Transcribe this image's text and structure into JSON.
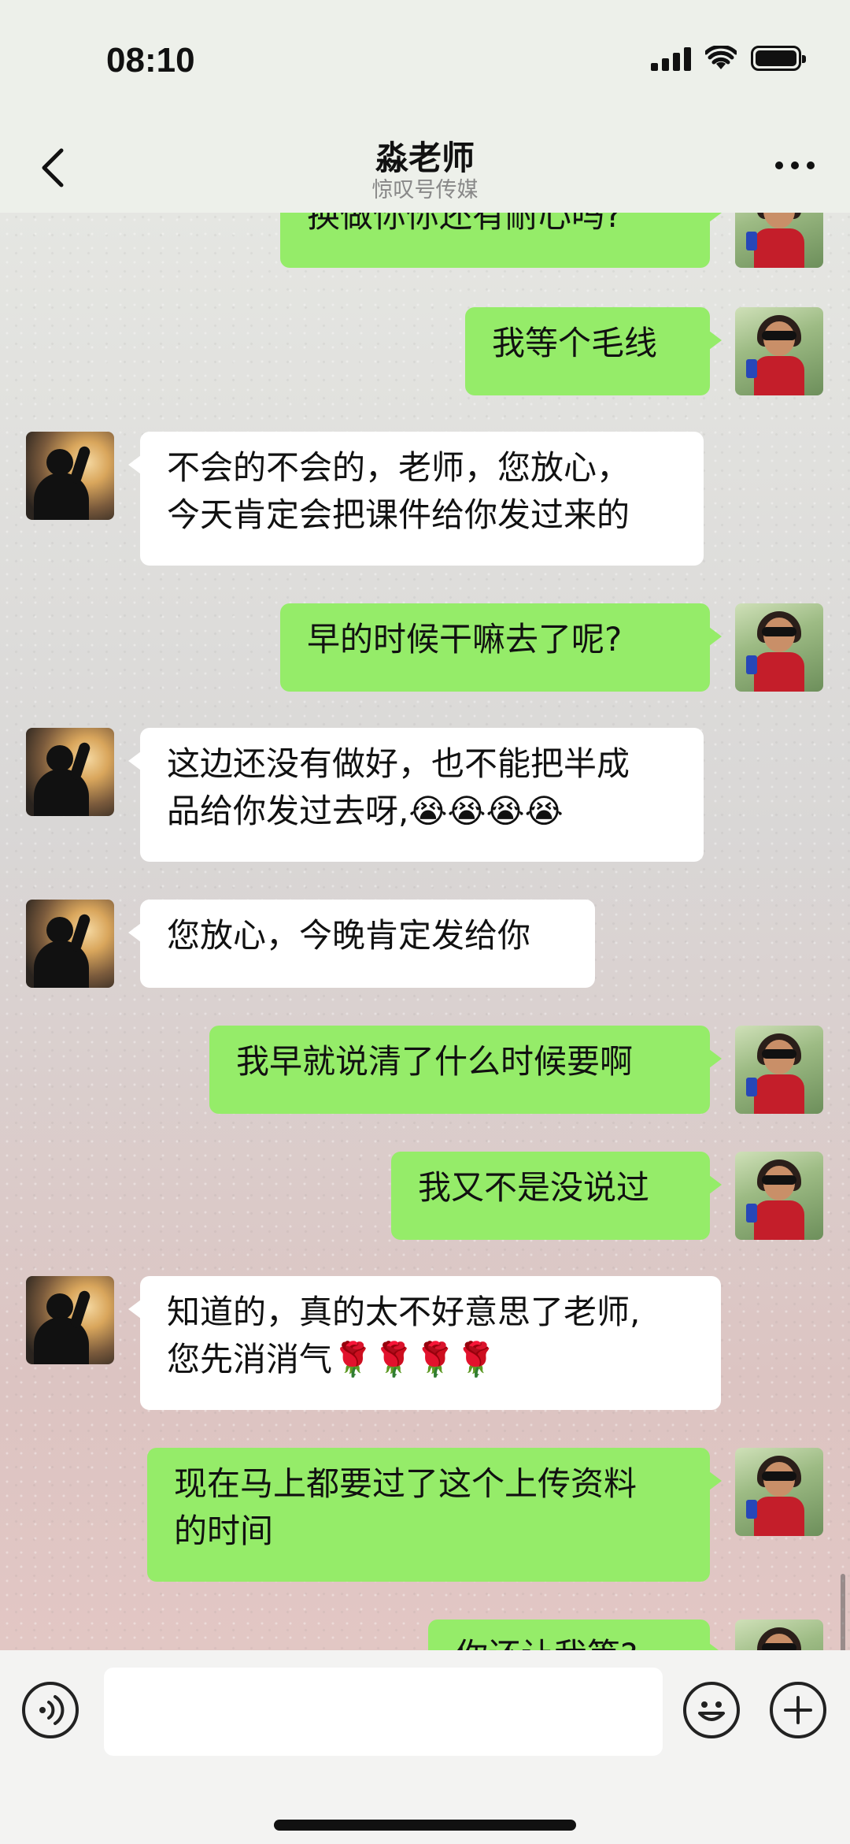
{
  "status_bar": {
    "time": "08:10"
  },
  "header": {
    "title": "淼老师",
    "subtitle": "惊叹号传媒"
  },
  "messages": [
    {
      "side": "me",
      "text": "换做你你还有耐心吗?"
    },
    {
      "side": "me",
      "text": "我等个毛线"
    },
    {
      "side": "other",
      "lines": [
        "不会的不会的，老师，您放心，",
        "今天肯定会把课件给你发过来的"
      ]
    },
    {
      "side": "me",
      "text": "早的时候干嘛去了呢?"
    },
    {
      "side": "other",
      "lines": [
        "这边还没有做好，也不能把半成",
        "品给你发过去呀,😭😭😭😭"
      ]
    },
    {
      "side": "other",
      "text": "您放心，今晚肯定发给你"
    },
    {
      "side": "me",
      "text": "我早就说清了什么时候要啊"
    },
    {
      "side": "me",
      "text": "我又不是没说过"
    },
    {
      "side": "other",
      "lines": [
        "知道的，真的太不好意思了老师,",
        "您先消消气🌹🌹🌹🌹"
      ]
    },
    {
      "side": "me",
      "lines": [
        "现在马上都要过了这个上传资料",
        "的时间"
      ]
    },
    {
      "side": "me",
      "text": "你还让我等?"
    }
  ],
  "input": {
    "placeholder": ""
  },
  "icons": {
    "back": "chevron-left-icon",
    "more": "more-dots-icon",
    "voice": "voice-icon",
    "emoji": "emoji-icon",
    "plus": "plus-icon"
  },
  "colors": {
    "me_bubble": "#95ec69",
    "other_bubble": "#ffffff"
  }
}
